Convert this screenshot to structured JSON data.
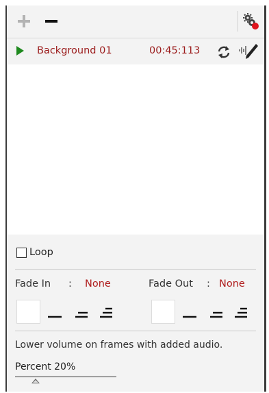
{
  "toolbar": {
    "add_icon": "plus-icon",
    "remove_icon": "minus-icon",
    "settings_icon": "gear-with-red-dot-icon"
  },
  "track": {
    "name": "Background 01",
    "duration": "00:45:113",
    "play_icon": "play-icon",
    "loop_icon": "refresh-icon",
    "edit_icon": "audio-pencil-icon",
    "text_color": "#9b1b1b"
  },
  "settings": {
    "loop_label": "Loop",
    "loop_checked": false,
    "fade_in": {
      "label": "Fade In",
      "separator": ":",
      "value": "None"
    },
    "fade_out": {
      "label": "Fade Out",
      "separator": ":",
      "value": "None"
    },
    "hint": "Lower volume on frames with added audio.",
    "percent_label": "Percent 20%",
    "percent_value": 20
  },
  "colors": {
    "accent_red": "#b01e1e",
    "play_green": "#1f8a1f",
    "panel_bg": "#f3f3f3"
  }
}
